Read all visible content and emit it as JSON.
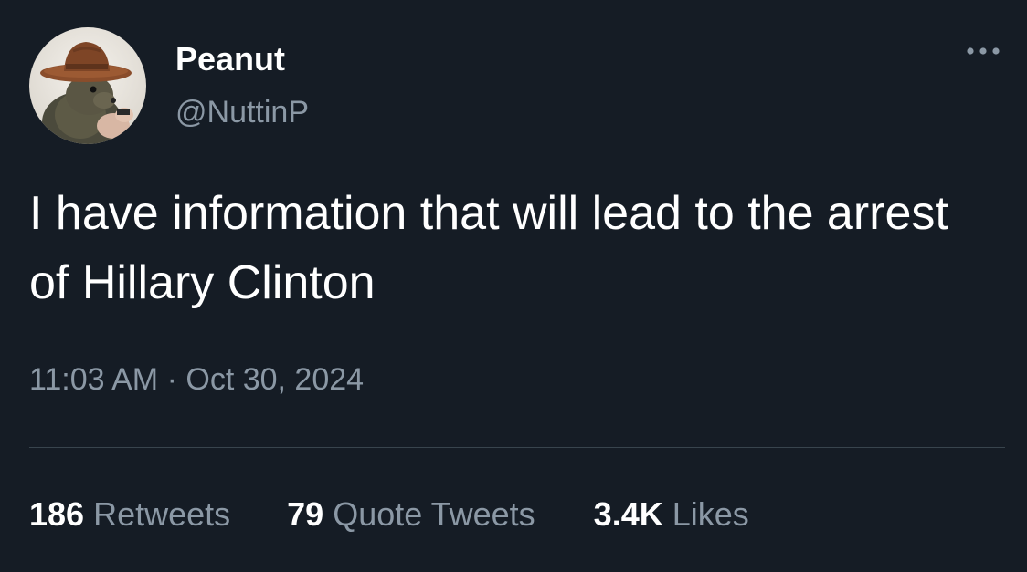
{
  "author": {
    "display_name": "Peanut",
    "handle": "@NuttinP",
    "avatar_icon": "squirrel-in-cowboy-hat-avatar"
  },
  "tweet": {
    "text": "I have information that will lead to the arrest of Hillary Clinton",
    "time": "11:03 AM",
    "separator": "·",
    "date": "Oct 30, 2024"
  },
  "stats": {
    "retweets_count": "186",
    "retweets_label": "Retweets",
    "quotes_count": "79",
    "quotes_label": "Quote Tweets",
    "likes_count": "3.4K",
    "likes_label": "Likes"
  },
  "colors": {
    "background": "#151c25",
    "primary_text": "#ffffff",
    "secondary_text": "#8b98a5",
    "divider": "#38444d"
  },
  "icons": {
    "more": "more-options-icon"
  }
}
